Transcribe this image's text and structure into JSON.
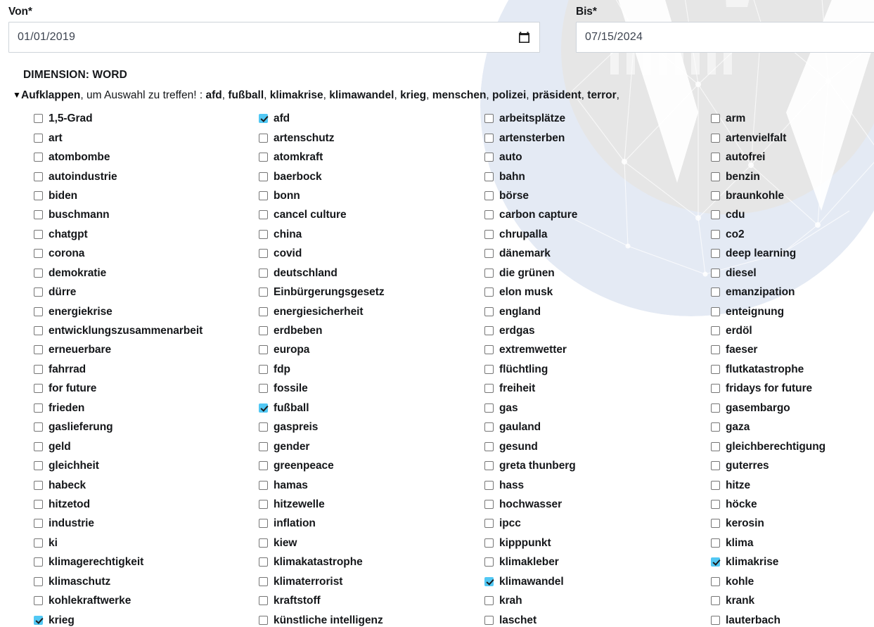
{
  "date_from": {
    "label": "Von*",
    "value": "01/01/2019",
    "icon": "calendar-icon"
  },
  "date_to": {
    "label": "Bis*",
    "value": "07/15/2024",
    "icon": "calendar-icon"
  },
  "dimension": {
    "title": "DIMENSION: WORD",
    "toggle_marker": "▼",
    "toggle_label": "Aufklappen",
    "hint_text": ", um Auswahl zu treffen! : ",
    "selected_summary": [
      "afd",
      "fußball",
      "klimakrise",
      "klimawandel",
      "krieg",
      "menschen",
      "polizei",
      "präsident",
      "terror"
    ],
    "summary_suffix": ","
  },
  "colors": {
    "checkbox_checked": "#52c8f4",
    "checkbox_border": "#767676",
    "text": "#15171a",
    "input_border": "#ced4da",
    "input_value": "#3d4450",
    "watermark_blue": "#e3eaf5",
    "watermark_grey": "#e5e5e5"
  },
  "columns": [
    {
      "items": [
        {
          "label": "1,5-Grad",
          "checked": false
        },
        {
          "label": "art",
          "checked": false
        },
        {
          "label": "atombombe",
          "checked": false
        },
        {
          "label": "autoindustrie",
          "checked": false
        },
        {
          "label": "biden",
          "checked": false
        },
        {
          "label": "buschmann",
          "checked": false
        },
        {
          "label": "chatgpt",
          "checked": false
        },
        {
          "label": "corona",
          "checked": false
        },
        {
          "label": "demokratie",
          "checked": false
        },
        {
          "label": "dürre",
          "checked": false
        },
        {
          "label": "energiekrise",
          "checked": false
        },
        {
          "label": "entwicklungszusammenarbeit",
          "checked": false
        },
        {
          "label": "erneuerbare",
          "checked": false
        },
        {
          "label": "fahrrad",
          "checked": false
        },
        {
          "label": "for future",
          "checked": false
        },
        {
          "label": "frieden",
          "checked": false
        },
        {
          "label": "gaslieferung",
          "checked": false
        },
        {
          "label": "geld",
          "checked": false
        },
        {
          "label": "gleichheit",
          "checked": false
        },
        {
          "label": "habeck",
          "checked": false
        },
        {
          "label": "hitzetod",
          "checked": false
        },
        {
          "label": "industrie",
          "checked": false
        },
        {
          "label": "ki",
          "checked": false
        },
        {
          "label": "klimagerechtigkeit",
          "checked": false
        },
        {
          "label": "klimaschutz",
          "checked": false
        },
        {
          "label": "kohlekraftwerke",
          "checked": false
        },
        {
          "label": "krieg",
          "checked": true
        }
      ]
    },
    {
      "items": [
        {
          "label": "afd",
          "checked": true
        },
        {
          "label": "artenschutz",
          "checked": false
        },
        {
          "label": "atomkraft",
          "checked": false
        },
        {
          "label": "baerbock",
          "checked": false
        },
        {
          "label": "bonn",
          "checked": false
        },
        {
          "label": "cancel culture",
          "checked": false
        },
        {
          "label": "china",
          "checked": false
        },
        {
          "label": "covid",
          "checked": false
        },
        {
          "label": "deutschland",
          "checked": false
        },
        {
          "label": "Einbürgerungsgesetz",
          "checked": false
        },
        {
          "label": "energiesicherheit",
          "checked": false
        },
        {
          "label": "erdbeben",
          "checked": false
        },
        {
          "label": "europa",
          "checked": false
        },
        {
          "label": "fdp",
          "checked": false
        },
        {
          "label": "fossile",
          "checked": false
        },
        {
          "label": "fußball",
          "checked": true
        },
        {
          "label": "gaspreis",
          "checked": false
        },
        {
          "label": "gender",
          "checked": false
        },
        {
          "label": "greenpeace",
          "checked": false
        },
        {
          "label": "hamas",
          "checked": false
        },
        {
          "label": "hitzewelle",
          "checked": false
        },
        {
          "label": "inflation",
          "checked": false
        },
        {
          "label": "kiew",
          "checked": false
        },
        {
          "label": "klimakatastrophe",
          "checked": false
        },
        {
          "label": "klimaterrorist",
          "checked": false
        },
        {
          "label": "kraftstoff",
          "checked": false
        },
        {
          "label": "künstliche intelligenz",
          "checked": false
        }
      ]
    },
    {
      "items": [
        {
          "label": "arbeitsplätze",
          "checked": false
        },
        {
          "label": "artensterben",
          "checked": false
        },
        {
          "label": "auto",
          "checked": false
        },
        {
          "label": "bahn",
          "checked": false
        },
        {
          "label": "börse",
          "checked": false
        },
        {
          "label": "carbon capture",
          "checked": false
        },
        {
          "label": "chrupalla",
          "checked": false
        },
        {
          "label": "dänemark",
          "checked": false
        },
        {
          "label": "die grünen",
          "checked": false
        },
        {
          "label": "elon musk",
          "checked": false
        },
        {
          "label": "england",
          "checked": false
        },
        {
          "label": "erdgas",
          "checked": false
        },
        {
          "label": "extremwetter",
          "checked": false
        },
        {
          "label": "flüchtling",
          "checked": false
        },
        {
          "label": "freiheit",
          "checked": false
        },
        {
          "label": "gas",
          "checked": false
        },
        {
          "label": "gauland",
          "checked": false
        },
        {
          "label": "gesund",
          "checked": false
        },
        {
          "label": "greta thunberg",
          "checked": false
        },
        {
          "label": "hass",
          "checked": false
        },
        {
          "label": "hochwasser",
          "checked": false
        },
        {
          "label": "ipcc",
          "checked": false
        },
        {
          "label": "kipppunkt",
          "checked": false
        },
        {
          "label": "klimakleber",
          "checked": false
        },
        {
          "label": "klimawandel",
          "checked": true
        },
        {
          "label": "krah",
          "checked": false
        },
        {
          "label": "laschet",
          "checked": false
        }
      ]
    },
    {
      "items": [
        {
          "label": "arm",
          "checked": false
        },
        {
          "label": "artenvielfalt",
          "checked": false
        },
        {
          "label": "autofrei",
          "checked": false
        },
        {
          "label": "benzin",
          "checked": false
        },
        {
          "label": "braunkohle",
          "checked": false
        },
        {
          "label": "cdu",
          "checked": false
        },
        {
          "label": "co2",
          "checked": false
        },
        {
          "label": "deep learning",
          "checked": false
        },
        {
          "label": "diesel",
          "checked": false
        },
        {
          "label": "emanzipation",
          "checked": false
        },
        {
          "label": "enteignung",
          "checked": false
        },
        {
          "label": "erdöl",
          "checked": false
        },
        {
          "label": "faeser",
          "checked": false
        },
        {
          "label": "flutkatastrophe",
          "checked": false
        },
        {
          "label": "fridays for future",
          "checked": false
        },
        {
          "label": "gasembargo",
          "checked": false
        },
        {
          "label": "gaza",
          "checked": false
        },
        {
          "label": "gleichberechtigung",
          "checked": false
        },
        {
          "label": "guterres",
          "checked": false
        },
        {
          "label": "hitze",
          "checked": false
        },
        {
          "label": "höcke",
          "checked": false
        },
        {
          "label": "kerosin",
          "checked": false
        },
        {
          "label": "klima",
          "checked": false
        },
        {
          "label": "klimakrise",
          "checked": true
        },
        {
          "label": "kohle",
          "checked": false
        },
        {
          "label": "krank",
          "checked": false
        },
        {
          "label": "lauterbach",
          "checked": false
        }
      ]
    }
  ]
}
